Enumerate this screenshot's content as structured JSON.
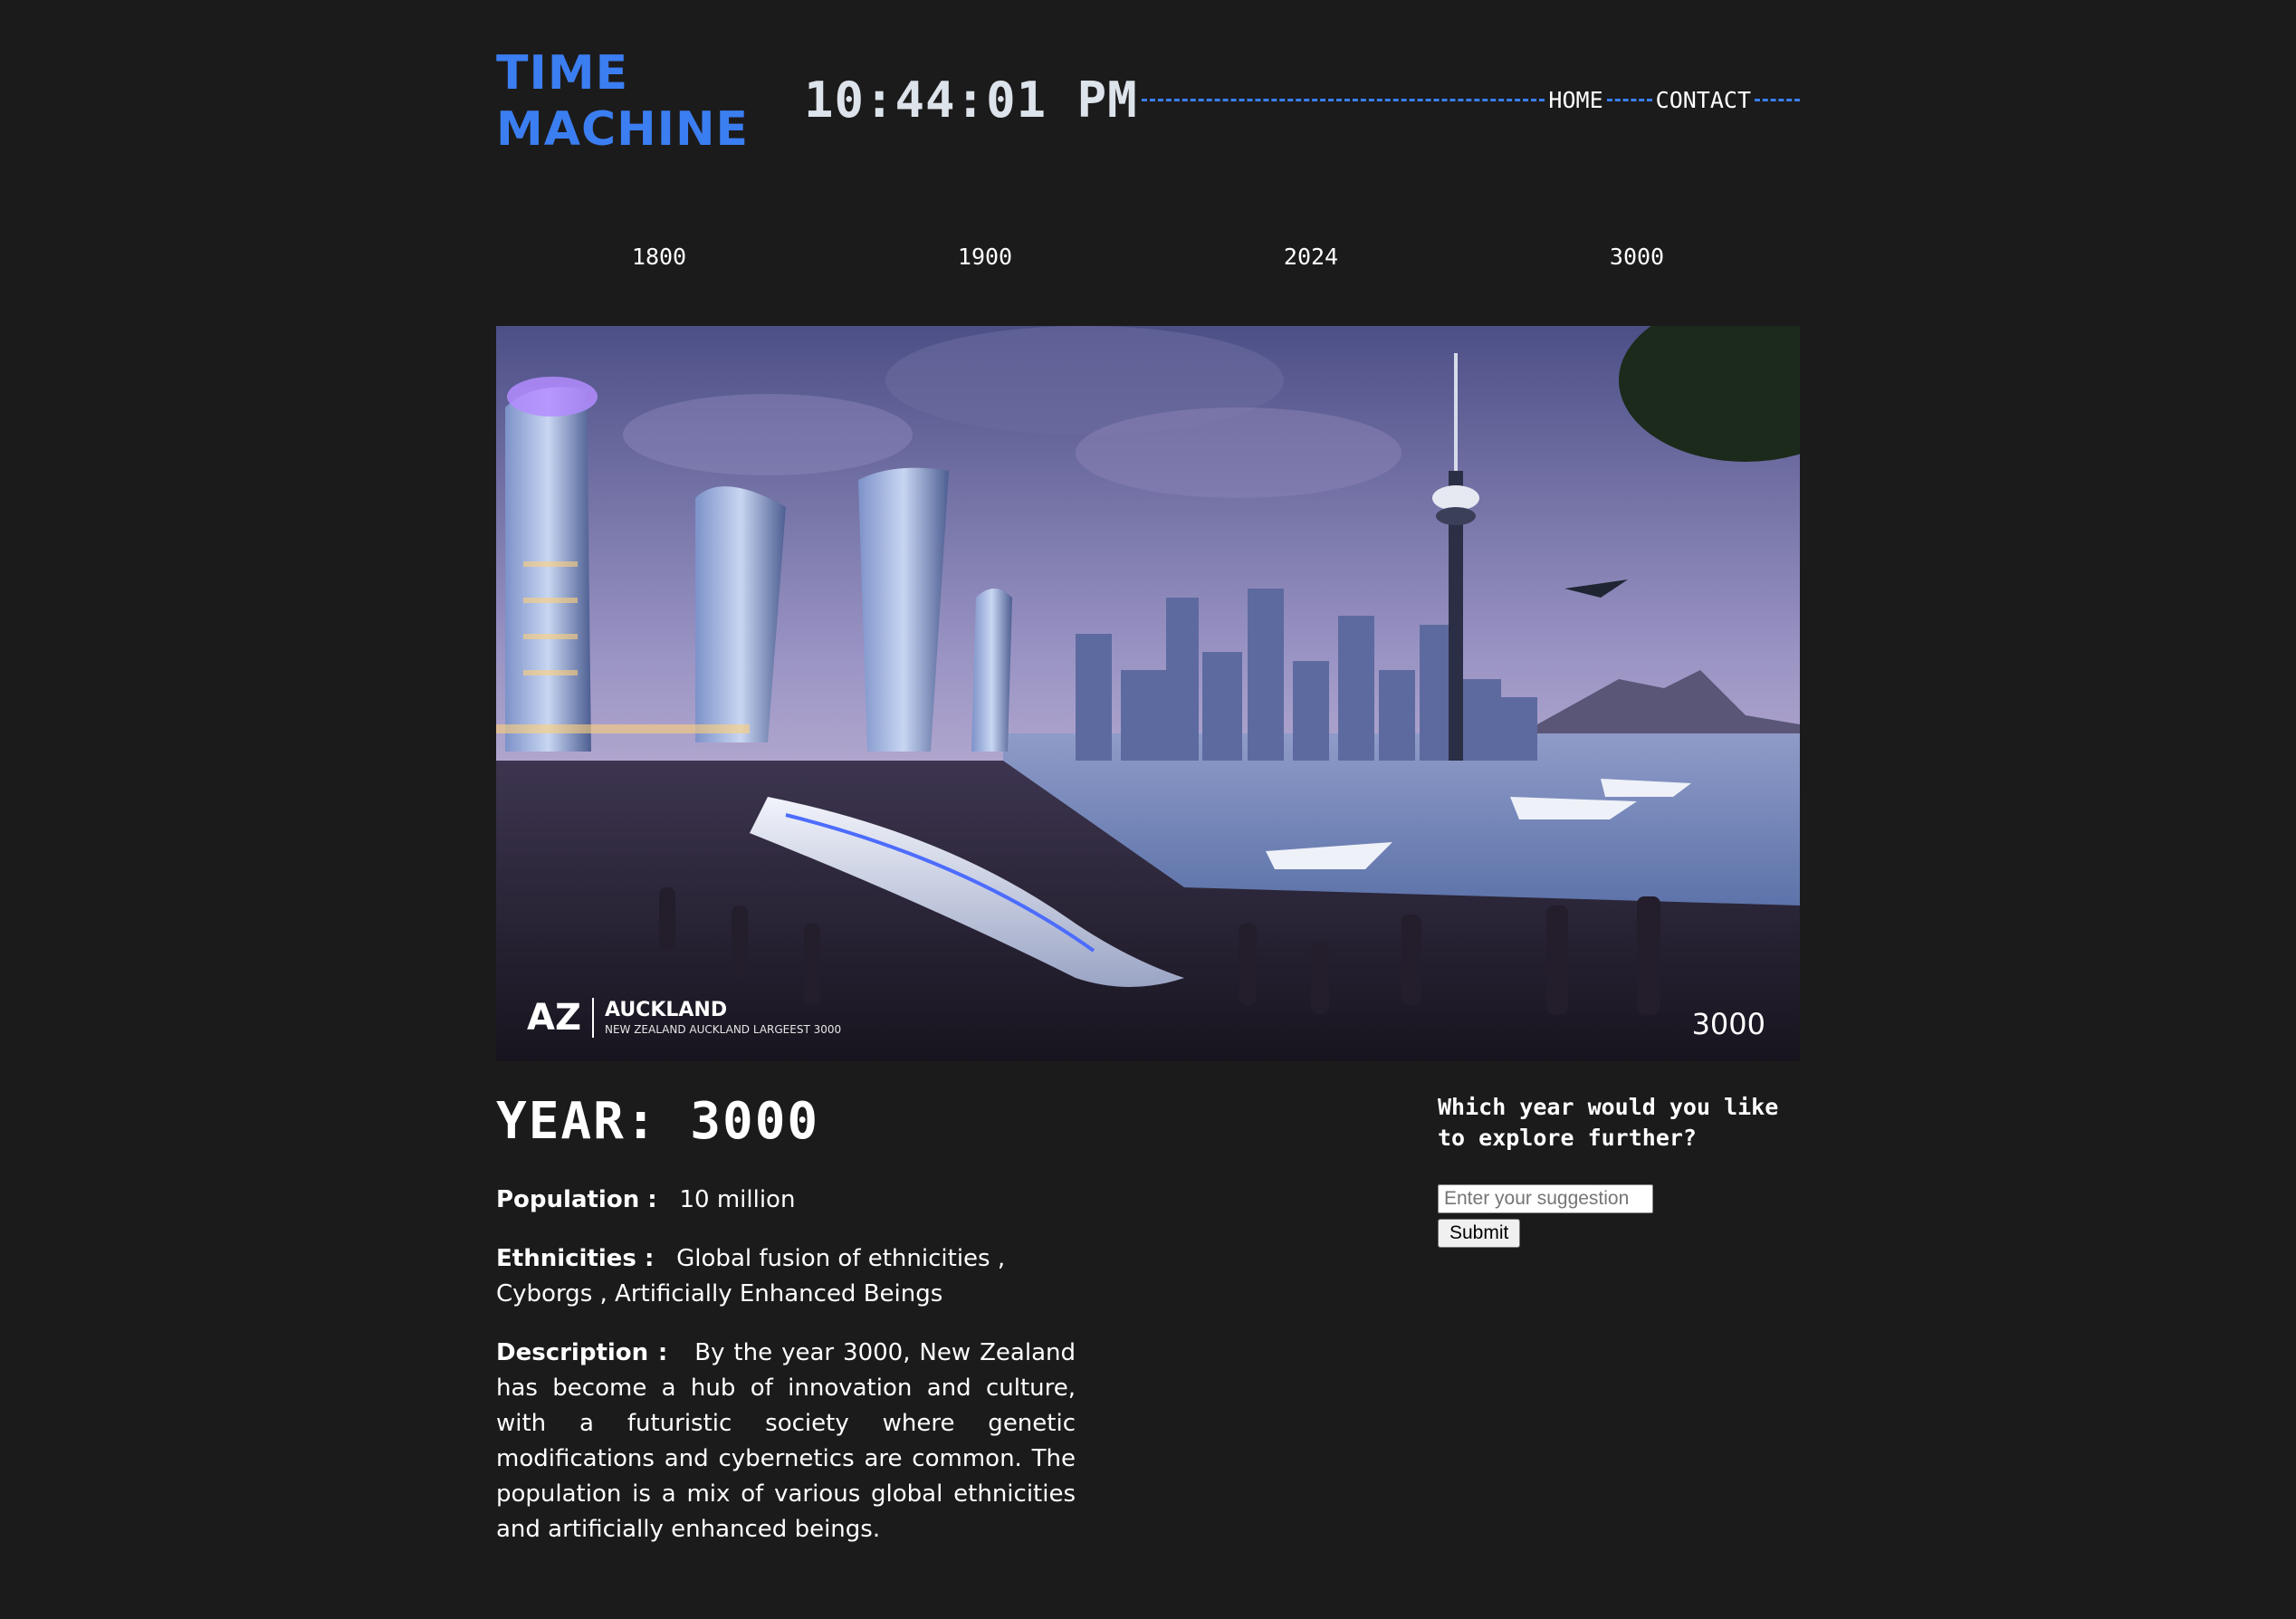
{
  "header": {
    "logo_line1": "TIME",
    "logo_line2": "MACHINE",
    "clock": "10:44:01 PM",
    "nav": [
      {
        "label": "HOME"
      },
      {
        "label": "CONTACT"
      }
    ]
  },
  "years": [
    "1800",
    "1900",
    "2024",
    "3000"
  ],
  "hero": {
    "brand_logo": "AZ",
    "brand_name": "AUCKLAND",
    "brand_tagline": "NEW ZEALAND AUCKLAND LARGEEST 3000",
    "year_stamp": "3000"
  },
  "detail": {
    "heading": "YEAR: 3000",
    "population_label": "Population :",
    "population_value": "10 million",
    "ethnicities_label": "Ethnicities :",
    "ethnicities_value": "Global fusion of ethnicities , Cyborgs , Artificially Enhanced Beings",
    "description_label": "Description :",
    "description_value": "By the year 3000, New Zealand has become a hub of innovation and culture, with a futuristic society where genetic modifications and cybernetics are common. The population is a mix of various global ethnicities and artificially enhanced beings."
  },
  "suggest": {
    "question": "Which year would you like to explore further?",
    "placeholder": "Enter your suggestion",
    "value": "",
    "submit_label": "Submit"
  },
  "colors": {
    "background": "#1c1b1c",
    "accent": "#3b7ef2",
    "text": "#ffffff"
  }
}
